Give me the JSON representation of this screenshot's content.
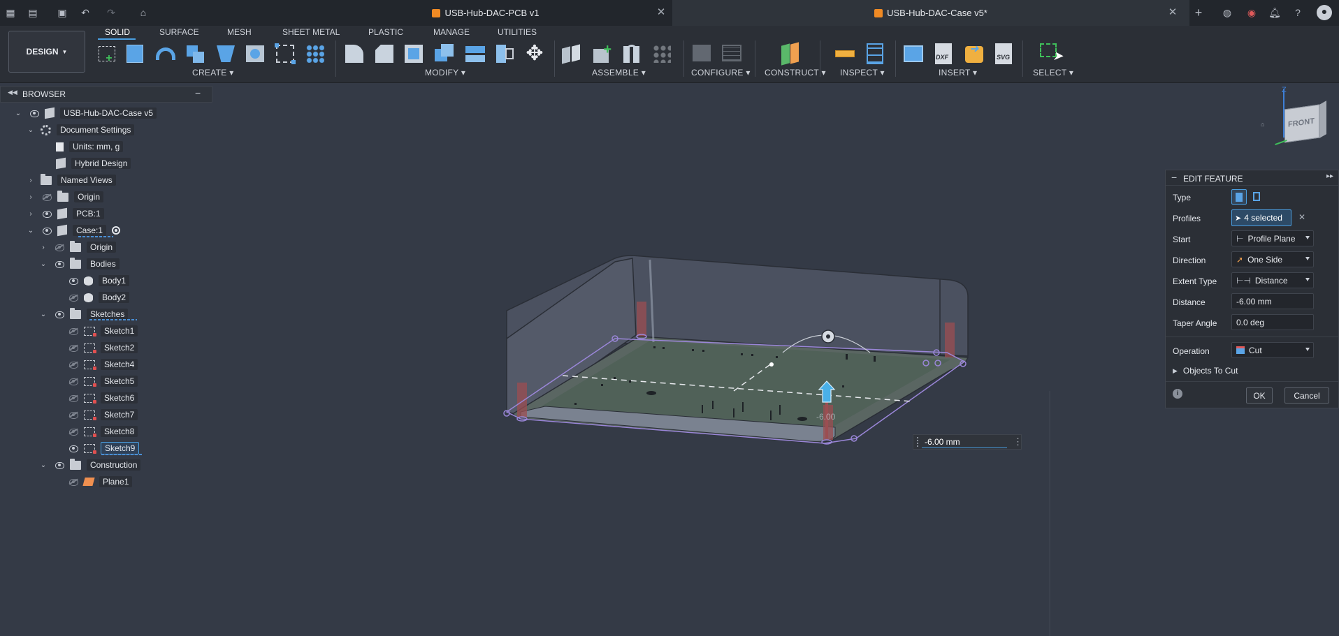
{
  "topbar": {
    "tabs": [
      {
        "title": "USB-Hub-DAC-PCB v1",
        "active": false
      },
      {
        "title": "USB-Hub-DAC-Case v5*",
        "active": true
      }
    ]
  },
  "toolbar": {
    "workspace": "DESIGN",
    "tabs": [
      "SOLID",
      "SURFACE",
      "MESH",
      "SHEET METAL",
      "PLASTIC",
      "MANAGE",
      "UTILITIES"
    ],
    "active_tab": "SOLID",
    "groups": [
      "CREATE",
      "MODIFY",
      "ASSEMBLE",
      "CONFIGURE",
      "CONSTRUCT",
      "INSPECT",
      "INSERT",
      "SELECT"
    ]
  },
  "browser": {
    "title": "BROWSER",
    "items": [
      {
        "label": "USB-Hub-DAC-Case v5"
      },
      {
        "label": "Document Settings"
      },
      {
        "label": "Units: mm, g"
      },
      {
        "label": "Hybrid Design"
      },
      {
        "label": "Named Views"
      },
      {
        "label": "Origin"
      },
      {
        "label": "PCB:1"
      },
      {
        "label": "Case:1"
      },
      {
        "label": "Origin"
      },
      {
        "label": "Bodies"
      },
      {
        "label": "Body1"
      },
      {
        "label": "Body2"
      },
      {
        "label": "Sketches"
      },
      {
        "label": "Sketch1"
      },
      {
        "label": "Sketch2"
      },
      {
        "label": "Sketch4"
      },
      {
        "label": "Sketch5"
      },
      {
        "label": "Sketch6"
      },
      {
        "label": "Sketch7"
      },
      {
        "label": "Sketch8"
      },
      {
        "label": "Sketch9"
      },
      {
        "label": "Construction"
      },
      {
        "label": "Plane1"
      }
    ]
  },
  "viewport": {
    "manipulator_label": "-6.00",
    "distance_input": "-6.00 mm",
    "navcube_face": "FRONT",
    "axis_z": "Z"
  },
  "edit_feature": {
    "title": "EDIT FEATURE",
    "rows": {
      "type": "Type",
      "profiles": "Profiles",
      "profiles_value": "4 selected",
      "start": "Start",
      "start_value": "Profile Plane",
      "direction": "Direction",
      "direction_value": "One Side",
      "extent_type": "Extent Type",
      "extent_value": "Distance",
      "distance": "Distance",
      "distance_value": "-6.00 mm",
      "taper": "Taper Angle",
      "taper_value": "0.0 deg",
      "operation": "Operation",
      "operation_value": "Cut",
      "objects_to_cut": "Objects To Cut"
    },
    "ok": "OK",
    "cancel": "Cancel"
  },
  "colors": {
    "accent": "#4a9ee0",
    "viewport_bg": "#343a46",
    "panel_bg": "#2b2f36"
  }
}
